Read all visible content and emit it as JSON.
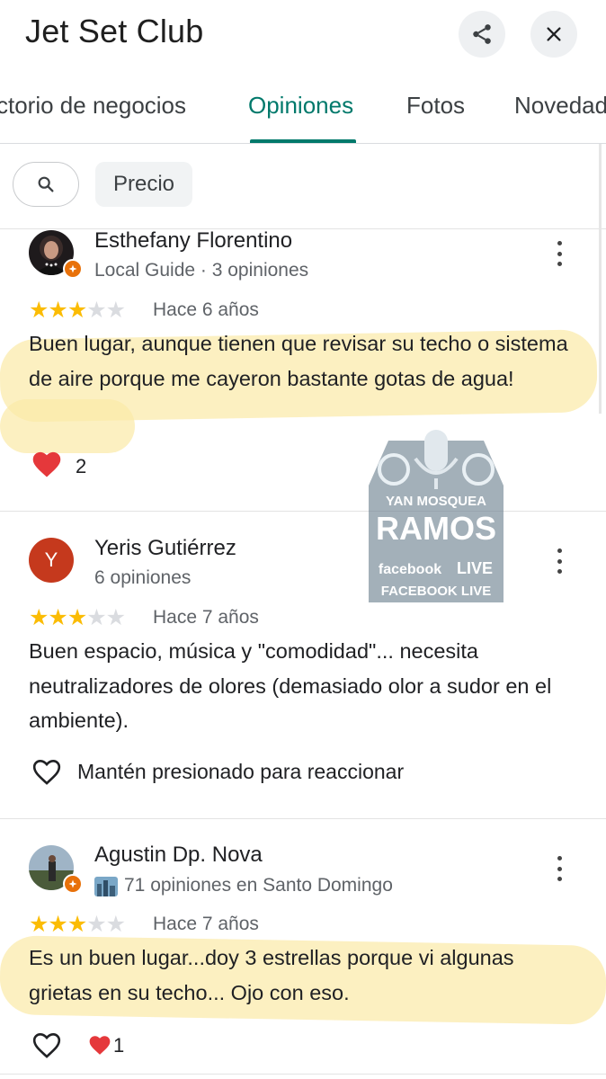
{
  "header": {
    "title": "Jet Set Club"
  },
  "tabs": [
    {
      "label": "ctorio de negocios",
      "active": false
    },
    {
      "label": "Opiniones",
      "active": true
    },
    {
      "label": "Fotos",
      "active": false
    },
    {
      "label": "Novedad",
      "active": false
    }
  ],
  "filters": {
    "chip_price": "Precio"
  },
  "reviews": [
    {
      "author": "Esthefany Florentino",
      "meta": "Local Guide · 3 opiniones",
      "rating": 3,
      "date": "Hace 6 años",
      "text": "Buen lugar, aunque tienen que revisar su techo o sistema de aire porque me cayeron bastante gotas de agua!",
      "reactions": "2"
    },
    {
      "author": "Yeris Gutiérrez",
      "avatar_letter": "Y",
      "meta": "6 opiniones",
      "rating": 3,
      "date": "Hace 7 años",
      "text": "Buen espacio, música y \"comodidad\"... necesita neutralizadores de olores (demasiado olor a sudor en el ambiente).",
      "react_hint": "Mantén presionado para reaccionar"
    },
    {
      "author": "Agustin Dp. Nova",
      "meta": "71 opiniones en Santo Domingo",
      "rating": 3,
      "date": "Hace 7 años",
      "text": "Es un buen lugar...doy 3 estrellas porque vi algunas grietas en su techo... Ojo con eso.",
      "reactions": "1"
    }
  ],
  "watermark": {
    "line1": "YAN MOSQUEA",
    "line2": "RAMOS",
    "line3": "facebook",
    "line4": "LIVE",
    "line5": "FACEBOOK LIVE"
  },
  "colors": {
    "accent": "#00796b",
    "star": "#fbbc04",
    "badge": "#e8710a",
    "avatar_y": "#c5391d"
  }
}
